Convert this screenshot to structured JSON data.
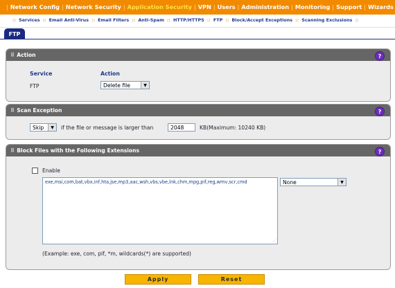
{
  "topnav": {
    "items": [
      "Network Config",
      "Network Security",
      "Application Security",
      "VPN",
      "Users",
      "Administration",
      "Monitoring",
      "Support",
      "Wizards"
    ]
  },
  "subnav": {
    "items": [
      "Services",
      "Email Anti-Virus",
      "Email Filters",
      "Anti-Spam",
      "HTTP/HTTPS",
      "FTP",
      "Block/Accept Exceptions",
      "Scanning Exclusions"
    ]
  },
  "tab": {
    "label": "FTP"
  },
  "action_panel": {
    "title": "Action",
    "service_header": "Service",
    "action_header": "Action",
    "service_value": "FTP",
    "action_value": "Delete file"
  },
  "scan_panel": {
    "title": "Scan Exception",
    "mode_value": "Skip",
    "text_before": "if the file or message is larger than",
    "size_value": "2048",
    "text_after": "KB(Maximum: 10240 KB)"
  },
  "block_panel": {
    "title": "Block Files with the Following Extensions",
    "enable_label": "Enable",
    "extensions_value": "exe,msi,com,bat,vbx,inf,hta,jse,mp3,aac,wsh,vbs,vbe,lnk,chm,mpg,pif,reg,wmv,scr,cmd",
    "preset_value": "None",
    "example_text": "(Example: exe, com, pif, *m, wildcards(*) are supported)"
  },
  "buttons": {
    "apply": "Apply",
    "reset": "Reset"
  },
  "icons": {
    "help": "?"
  },
  "colors": {
    "nav_orange": "#f28a00",
    "tab_blue": "#1b2a80",
    "panel_header": "#666666",
    "button_yellow": "#f7b500",
    "help_purple": "#6a2fb6"
  }
}
